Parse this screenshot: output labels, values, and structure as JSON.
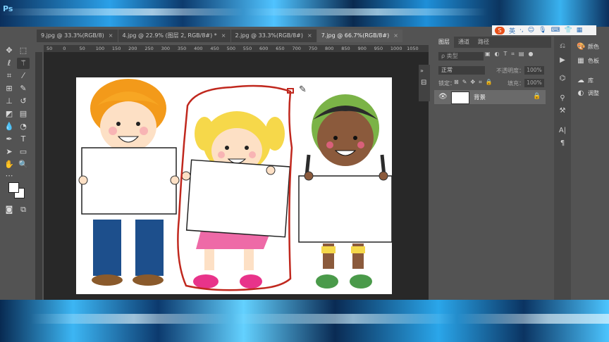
{
  "app": {
    "logo": "Ps"
  },
  "ime": {
    "logo": "S",
    "label": "英",
    "icons": [
      "·,",
      "☺",
      "🎙",
      "⌨",
      "👕",
      "▦"
    ]
  },
  "tabs": [
    {
      "label": "9.jpg @ 33.3%(RGB/8)",
      "close": "×",
      "active": false
    },
    {
      "label": "4.jpg @ 22.9% (图层 2, RGB/8#) *",
      "close": "×",
      "active": false
    },
    {
      "label": "2.jpg @ 33.3%(RGB/8#)",
      "close": "×",
      "active": false
    },
    {
      "label": "7.jpg @ 66.7%(RGB/8#)",
      "close": "×",
      "active": true
    }
  ],
  "ruler": {
    "ticks": [
      "50",
      "0",
      "50",
      "100",
      "150",
      "200",
      "250",
      "300",
      "350",
      "400",
      "450",
      "500",
      "550",
      "600",
      "650",
      "700",
      "750",
      "800",
      "850",
      "900",
      "950",
      "1000",
      "1050"
    ]
  },
  "layers_panel": {
    "tabs": [
      "图层",
      "通道",
      "路径"
    ],
    "active_tab": "图层",
    "filter_placeholder": "ρ 类型",
    "blend_mode": "正常",
    "opacity_label": "不透明度：",
    "opacity_value": "100%",
    "lock_label": "锁定：",
    "fill_label": "填充：",
    "fill_value": "100%",
    "layers": [
      {
        "name": "背景",
        "visible": true,
        "locked": true
      }
    ]
  },
  "right_dock": {
    "items": [
      {
        "icon": "palette-icon",
        "label": "颜色"
      },
      {
        "icon": "swatches-icon",
        "label": "色板"
      },
      {
        "icon": "libraries-icon",
        "label": "库"
      },
      {
        "icon": "adjustments-icon",
        "label": "调整"
      }
    ]
  },
  "colors": {
    "foreground": "#ffffff",
    "background": "#ffffff",
    "selection_stroke": "#c0281e",
    "app_bg": "#535353",
    "canvas_bg": "#282828"
  }
}
